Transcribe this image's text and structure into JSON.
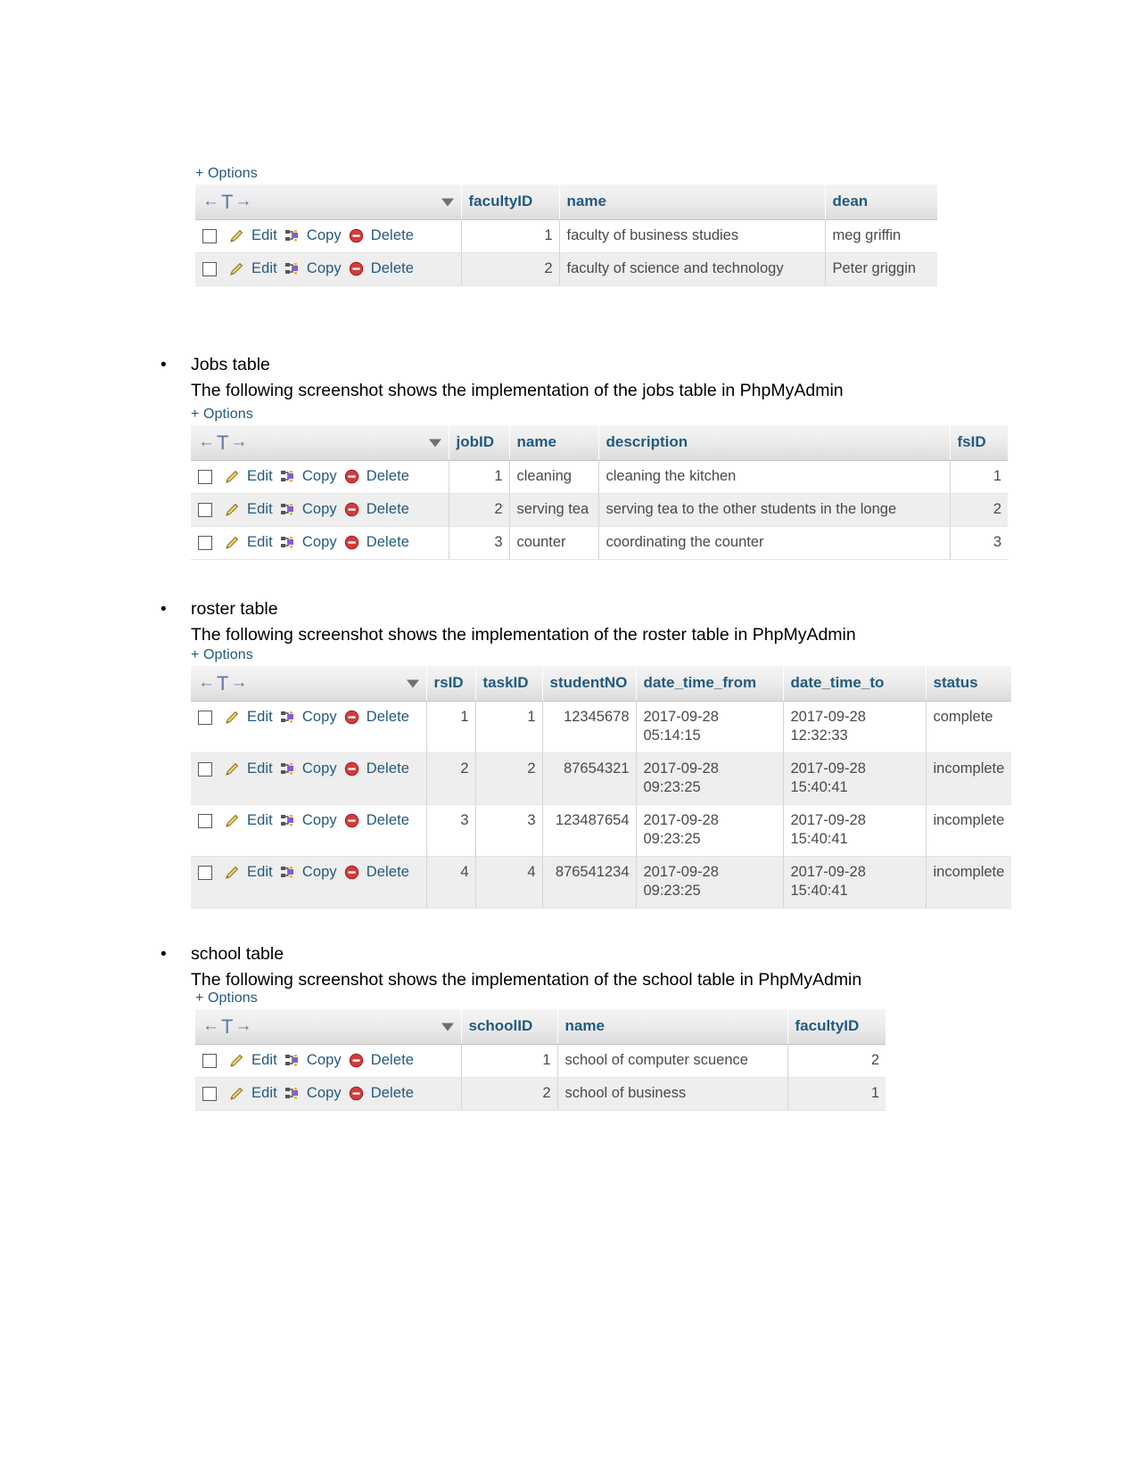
{
  "document": {
    "sections": [
      {
        "id": "faculty",
        "bullet": "",
        "caption": ""
      },
      {
        "id": "jobs",
        "bullet": "Jobs table",
        "caption": "The following screenshot shows the implementation of the jobs table in PhpMyAdmin"
      },
      {
        "id": "roster",
        "bullet": "roster table",
        "caption": "The following screenshot shows the implementation of the roster table in PhpMyAdmin"
      },
      {
        "id": "school",
        "bullet": "school table",
        "caption": "The following screenshot shows the implementation of the school table in PhpMyAdmin"
      }
    ]
  },
  "common": {
    "options_label": "+ Options",
    "nav_left_arrow": "←",
    "nav_t": "T",
    "nav_right_arrow": "→",
    "edit_label": "Edit",
    "copy_label": "Copy",
    "delete_label": "Delete",
    "icons": {
      "edit": "pencil-icon",
      "copy": "copy-icon",
      "delete": "delete-circle-icon",
      "sort": "sort-caret-icon",
      "checkbox": "row-checkbox"
    },
    "colors": {
      "header_text": "#235a81",
      "link": "#235a81",
      "cell_text": "#4a4a4a",
      "row_even_bg": "#eeeeee",
      "row_odd_bg": "#ffffff",
      "header_bg": "#e8e8e8",
      "delete_icon": "#cc2b2b",
      "edit_icon": "#e8c24a"
    }
  },
  "tables": {
    "faculty": {
      "columns": [
        "facultyID",
        "name",
        "dean"
      ],
      "rows": [
        {
          "facultyID": "1",
          "name": "faculty of business studies",
          "dean": "meg griffin"
        },
        {
          "facultyID": "2",
          "name": "faculty of science and technology",
          "dean": "Peter griggin"
        }
      ]
    },
    "jobs": {
      "columns": [
        "jobID",
        "name",
        "description",
        "fsID"
      ],
      "rows": [
        {
          "jobID": "1",
          "name": "cleaning",
          "description": "cleaning the kitchen",
          "fsID": "1"
        },
        {
          "jobID": "2",
          "name": "serving tea",
          "description": "serving tea to the other students in the longe",
          "fsID": "2"
        },
        {
          "jobID": "3",
          "name": "counter",
          "description": "coordinating the counter",
          "fsID": "3"
        }
      ]
    },
    "roster": {
      "columns": [
        "rsID",
        "taskID",
        "studentNO",
        "date_time_from",
        "date_time_to",
        "status"
      ],
      "rows": [
        {
          "rsID": "1",
          "taskID": "1",
          "studentNO": "12345678",
          "date_time_from": "2017-09-28 05:14:15",
          "date_time_to": "2017-09-28 12:32:33",
          "status": "complete"
        },
        {
          "rsID": "2",
          "taskID": "2",
          "studentNO": "87654321",
          "date_time_from": "2017-09-28 09:23:25",
          "date_time_to": "2017-09-28 15:40:41",
          "status": "incomplete"
        },
        {
          "rsID": "3",
          "taskID": "3",
          "studentNO": "123487654",
          "date_time_from": "2017-09-28 09:23:25",
          "date_time_to": "2017-09-28 15:40:41",
          "status": "incomplete"
        },
        {
          "rsID": "4",
          "taskID": "4",
          "studentNO": "876541234",
          "date_time_from": "2017-09-28 09:23:25",
          "date_time_to": "2017-09-28 15:40:41",
          "status": "incomplete"
        }
      ]
    },
    "school": {
      "columns": [
        "schoolID",
        "name",
        "facultyID"
      ],
      "rows": [
        {
          "schoolID": "1",
          "name": "school of computer scuence",
          "facultyID": "2"
        },
        {
          "schoolID": "2",
          "name": "school of business",
          "facultyID": "1"
        }
      ]
    }
  }
}
